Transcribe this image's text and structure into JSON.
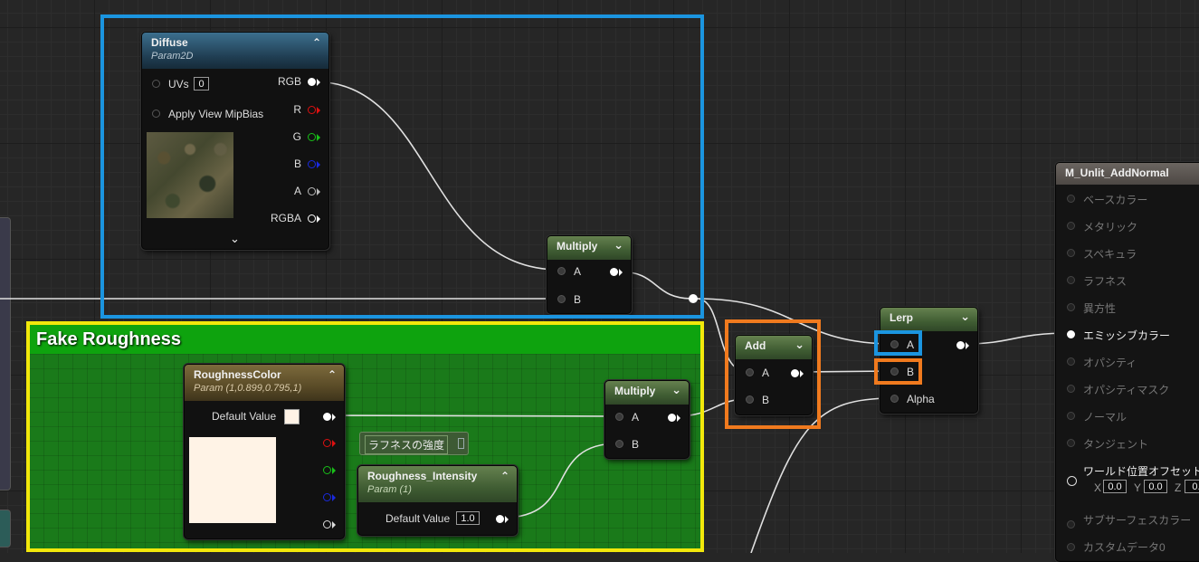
{
  "colors": {
    "highlight_blue": "#1b95e0",
    "highlight_yellow": "#f2e80b",
    "highlight_orange": "#f07a1e",
    "comment_green": "#0ea30e",
    "wire": "#e0e0e0"
  },
  "diffuse_node": {
    "title": "Diffuse",
    "subtitle": "Param2D",
    "uvs_label": "UVs",
    "uvs_value": "0",
    "mipbias_label": "Apply View MipBias",
    "outputs": [
      "RGB",
      "R",
      "G",
      "B",
      "A",
      "RGBA"
    ],
    "texture_icon": "texture-thumbnail",
    "expand_icon": "chevron-down-icon",
    "collapse_icon": "chevron-up-icon"
  },
  "multiply_top": {
    "title": "Multiply",
    "input_a": "A",
    "input_b": "B"
  },
  "comment": {
    "title": "Fake Roughness"
  },
  "roughness_color_node": {
    "title": "RoughnessColor",
    "subtitle": "Param (1,0.899,0.795,1)",
    "default_label": "Default Value",
    "swatch_color": "#fff3e6"
  },
  "roughness_label_box": {
    "text": "ラフネスの強度"
  },
  "roughness_intensity_node": {
    "title": "Roughness_Intensity",
    "subtitle": "Param (1)",
    "default_label": "Default Value",
    "default_value": "1.0"
  },
  "multiply_bottom": {
    "title": "Multiply",
    "input_a": "A",
    "input_b": "B"
  },
  "add_node": {
    "title": "Add",
    "input_a": "A",
    "input_b": "B"
  },
  "lerp_node": {
    "title": "Lerp",
    "input_a": "A",
    "input_b": "B",
    "input_alpha": "Alpha"
  },
  "material_node": {
    "title": "M_Unlit_AddNormal",
    "pins": [
      "ベースカラー",
      "メタリック",
      "スペキュラ",
      "ラフネス",
      "異方性",
      "エミッシブカラー",
      "オパシティ",
      "オパシティマスク",
      "ノーマル",
      "タンジェント",
      "ワールド位置オフセット",
      "サブサーフェスカラー",
      "カスタムデータ0"
    ],
    "wpo_x_label": "X",
    "wpo_x": "0.0",
    "wpo_y_label": "Y",
    "wpo_y": "0.0",
    "wpo_z_label": "Z",
    "wpo_z": "0."
  }
}
